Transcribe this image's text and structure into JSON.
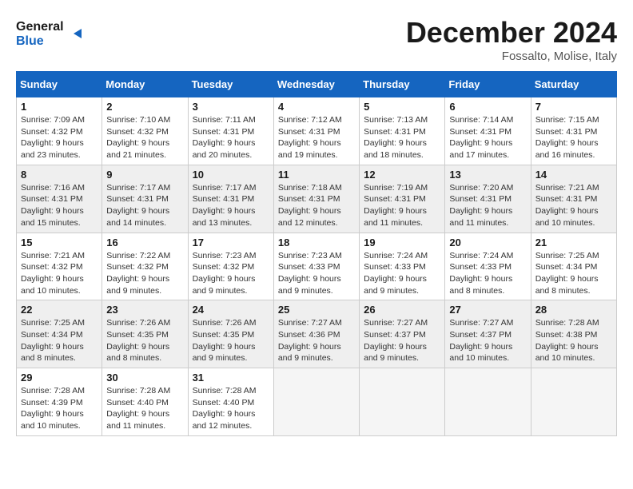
{
  "header": {
    "logo_general": "General",
    "logo_blue": "Blue",
    "month_title": "December 2024",
    "location": "Fossalto, Molise, Italy"
  },
  "calendar": {
    "days_of_week": [
      "Sunday",
      "Monday",
      "Tuesday",
      "Wednesday",
      "Thursday",
      "Friday",
      "Saturday"
    ],
    "weeks": [
      [
        {
          "day": "1",
          "sunrise": "7:09 AM",
          "sunset": "4:32 PM",
          "daylight": "9 hours and 23 minutes."
        },
        {
          "day": "2",
          "sunrise": "7:10 AM",
          "sunset": "4:32 PM",
          "daylight": "9 hours and 21 minutes."
        },
        {
          "day": "3",
          "sunrise": "7:11 AM",
          "sunset": "4:31 PM",
          "daylight": "9 hours and 20 minutes."
        },
        {
          "day": "4",
          "sunrise": "7:12 AM",
          "sunset": "4:31 PM",
          "daylight": "9 hours and 19 minutes."
        },
        {
          "day": "5",
          "sunrise": "7:13 AM",
          "sunset": "4:31 PM",
          "daylight": "9 hours and 18 minutes."
        },
        {
          "day": "6",
          "sunrise": "7:14 AM",
          "sunset": "4:31 PM",
          "daylight": "9 hours and 17 minutes."
        },
        {
          "day": "7",
          "sunrise": "7:15 AM",
          "sunset": "4:31 PM",
          "daylight": "9 hours and 16 minutes."
        }
      ],
      [
        {
          "day": "8",
          "sunrise": "7:16 AM",
          "sunset": "4:31 PM",
          "daylight": "9 hours and 15 minutes."
        },
        {
          "day": "9",
          "sunrise": "7:17 AM",
          "sunset": "4:31 PM",
          "daylight": "9 hours and 14 minutes."
        },
        {
          "day": "10",
          "sunrise": "7:17 AM",
          "sunset": "4:31 PM",
          "daylight": "9 hours and 13 minutes."
        },
        {
          "day": "11",
          "sunrise": "7:18 AM",
          "sunset": "4:31 PM",
          "daylight": "9 hours and 12 minutes."
        },
        {
          "day": "12",
          "sunrise": "7:19 AM",
          "sunset": "4:31 PM",
          "daylight": "9 hours and 11 minutes."
        },
        {
          "day": "13",
          "sunrise": "7:20 AM",
          "sunset": "4:31 PM",
          "daylight": "9 hours and 11 minutes."
        },
        {
          "day": "14",
          "sunrise": "7:21 AM",
          "sunset": "4:31 PM",
          "daylight": "9 hours and 10 minutes."
        }
      ],
      [
        {
          "day": "15",
          "sunrise": "7:21 AM",
          "sunset": "4:32 PM",
          "daylight": "9 hours and 10 minutes."
        },
        {
          "day": "16",
          "sunrise": "7:22 AM",
          "sunset": "4:32 PM",
          "daylight": "9 hours and 9 minutes."
        },
        {
          "day": "17",
          "sunrise": "7:23 AM",
          "sunset": "4:32 PM",
          "daylight": "9 hours and 9 minutes."
        },
        {
          "day": "18",
          "sunrise": "7:23 AM",
          "sunset": "4:33 PM",
          "daylight": "9 hours and 9 minutes."
        },
        {
          "day": "19",
          "sunrise": "7:24 AM",
          "sunset": "4:33 PM",
          "daylight": "9 hours and 9 minutes."
        },
        {
          "day": "20",
          "sunrise": "7:24 AM",
          "sunset": "4:33 PM",
          "daylight": "9 hours and 8 minutes."
        },
        {
          "day": "21",
          "sunrise": "7:25 AM",
          "sunset": "4:34 PM",
          "daylight": "9 hours and 8 minutes."
        }
      ],
      [
        {
          "day": "22",
          "sunrise": "7:25 AM",
          "sunset": "4:34 PM",
          "daylight": "9 hours and 8 minutes."
        },
        {
          "day": "23",
          "sunrise": "7:26 AM",
          "sunset": "4:35 PM",
          "daylight": "9 hours and 8 minutes."
        },
        {
          "day": "24",
          "sunrise": "7:26 AM",
          "sunset": "4:35 PM",
          "daylight": "9 hours and 9 minutes."
        },
        {
          "day": "25",
          "sunrise": "7:27 AM",
          "sunset": "4:36 PM",
          "daylight": "9 hours and 9 minutes."
        },
        {
          "day": "26",
          "sunrise": "7:27 AM",
          "sunset": "4:37 PM",
          "daylight": "9 hours and 9 minutes."
        },
        {
          "day": "27",
          "sunrise": "7:27 AM",
          "sunset": "4:37 PM",
          "daylight": "9 hours and 10 minutes."
        },
        {
          "day": "28",
          "sunrise": "7:28 AM",
          "sunset": "4:38 PM",
          "daylight": "9 hours and 10 minutes."
        }
      ],
      [
        {
          "day": "29",
          "sunrise": "7:28 AM",
          "sunset": "4:39 PM",
          "daylight": "9 hours and 10 minutes."
        },
        {
          "day": "30",
          "sunrise": "7:28 AM",
          "sunset": "4:40 PM",
          "daylight": "9 hours and 11 minutes."
        },
        {
          "day": "31",
          "sunrise": "7:28 AM",
          "sunset": "4:40 PM",
          "daylight": "9 hours and 12 minutes."
        },
        null,
        null,
        null,
        null
      ]
    ]
  }
}
